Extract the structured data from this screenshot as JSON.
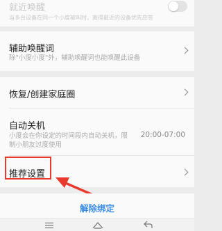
{
  "nearby_wake": {
    "title": "就近唤醒",
    "desc": "当多台设备在同一个小度被叫时，离得最近的设备优先应答",
    "enabled": false
  },
  "aux_wake": {
    "title": "辅助唤醒词",
    "desc": "除\"小度小度\"外，辅助唤醒词也能唤醒此设备"
  },
  "family": {
    "title": "恢复/创建家庭圈"
  },
  "auto_shutdown": {
    "title": "自动关机",
    "desc_line1": "小度会在你设定的时间段内自动关机，限",
    "desc_line2": "制小朋友过度使用",
    "value": "20:00-07:00"
  },
  "recommend": {
    "title": "推荐设置"
  },
  "unbind": {
    "label": "解除绑定"
  },
  "colors": {
    "accent": "#3d8ee8",
    "annotation": "#e8392c"
  },
  "navbar": {
    "icons": [
      "menu-icon",
      "home-icon",
      "back-icon"
    ]
  }
}
